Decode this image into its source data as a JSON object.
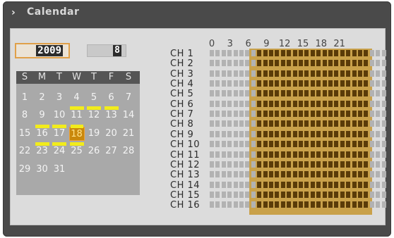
{
  "window": {
    "title": "Calendar",
    "title_icon": "chevron-right-icon"
  },
  "date": {
    "year": "2009",
    "month": "8"
  },
  "calendar": {
    "weekdays": [
      "S",
      "M",
      "T",
      "W",
      "T",
      "F",
      "S"
    ],
    "weeks": [
      [
        "",
        "",
        "",
        "",
        "",
        "",
        ""
      ],
      [
        "1",
        "2",
        "3",
        "4",
        "5",
        "6",
        "7"
      ],
      [
        "8",
        "9",
        "10",
        "11",
        "12",
        "13",
        "14"
      ],
      [
        "15",
        "16",
        "17",
        "18",
        "19",
        "20",
        "21"
      ],
      [
        "22",
        "23",
        "24",
        "25",
        "26",
        "27",
        "28"
      ],
      [
        "29",
        "30",
        "31",
        "",
        "",
        "",
        ""
      ]
    ],
    "recorded_days": [
      "11",
      "12",
      "13",
      "16",
      "17",
      "18",
      "23",
      "24",
      "25"
    ],
    "selected_day": "18"
  },
  "schedule": {
    "hours": [
      "0",
      "3",
      "6",
      "9",
      "12",
      "15",
      "18",
      "21"
    ],
    "channels": [
      "CH 1",
      "CH 2",
      "CH 3",
      "CH 4",
      "CH 5",
      "CH 6",
      "CH 7",
      "CH 8",
      "CH 9",
      "CH 10",
      "CH 11",
      "CH 12",
      "CH 13",
      "CH 14",
      "CH 15",
      "CH 16"
    ],
    "recording_start_hour": 8,
    "recording_end_hour": 22,
    "colors": {
      "recorded": "#5a3b08",
      "empty": "#b2b2b2",
      "highlight": "#f2ec1c",
      "selected": "#c9880c"
    }
  }
}
